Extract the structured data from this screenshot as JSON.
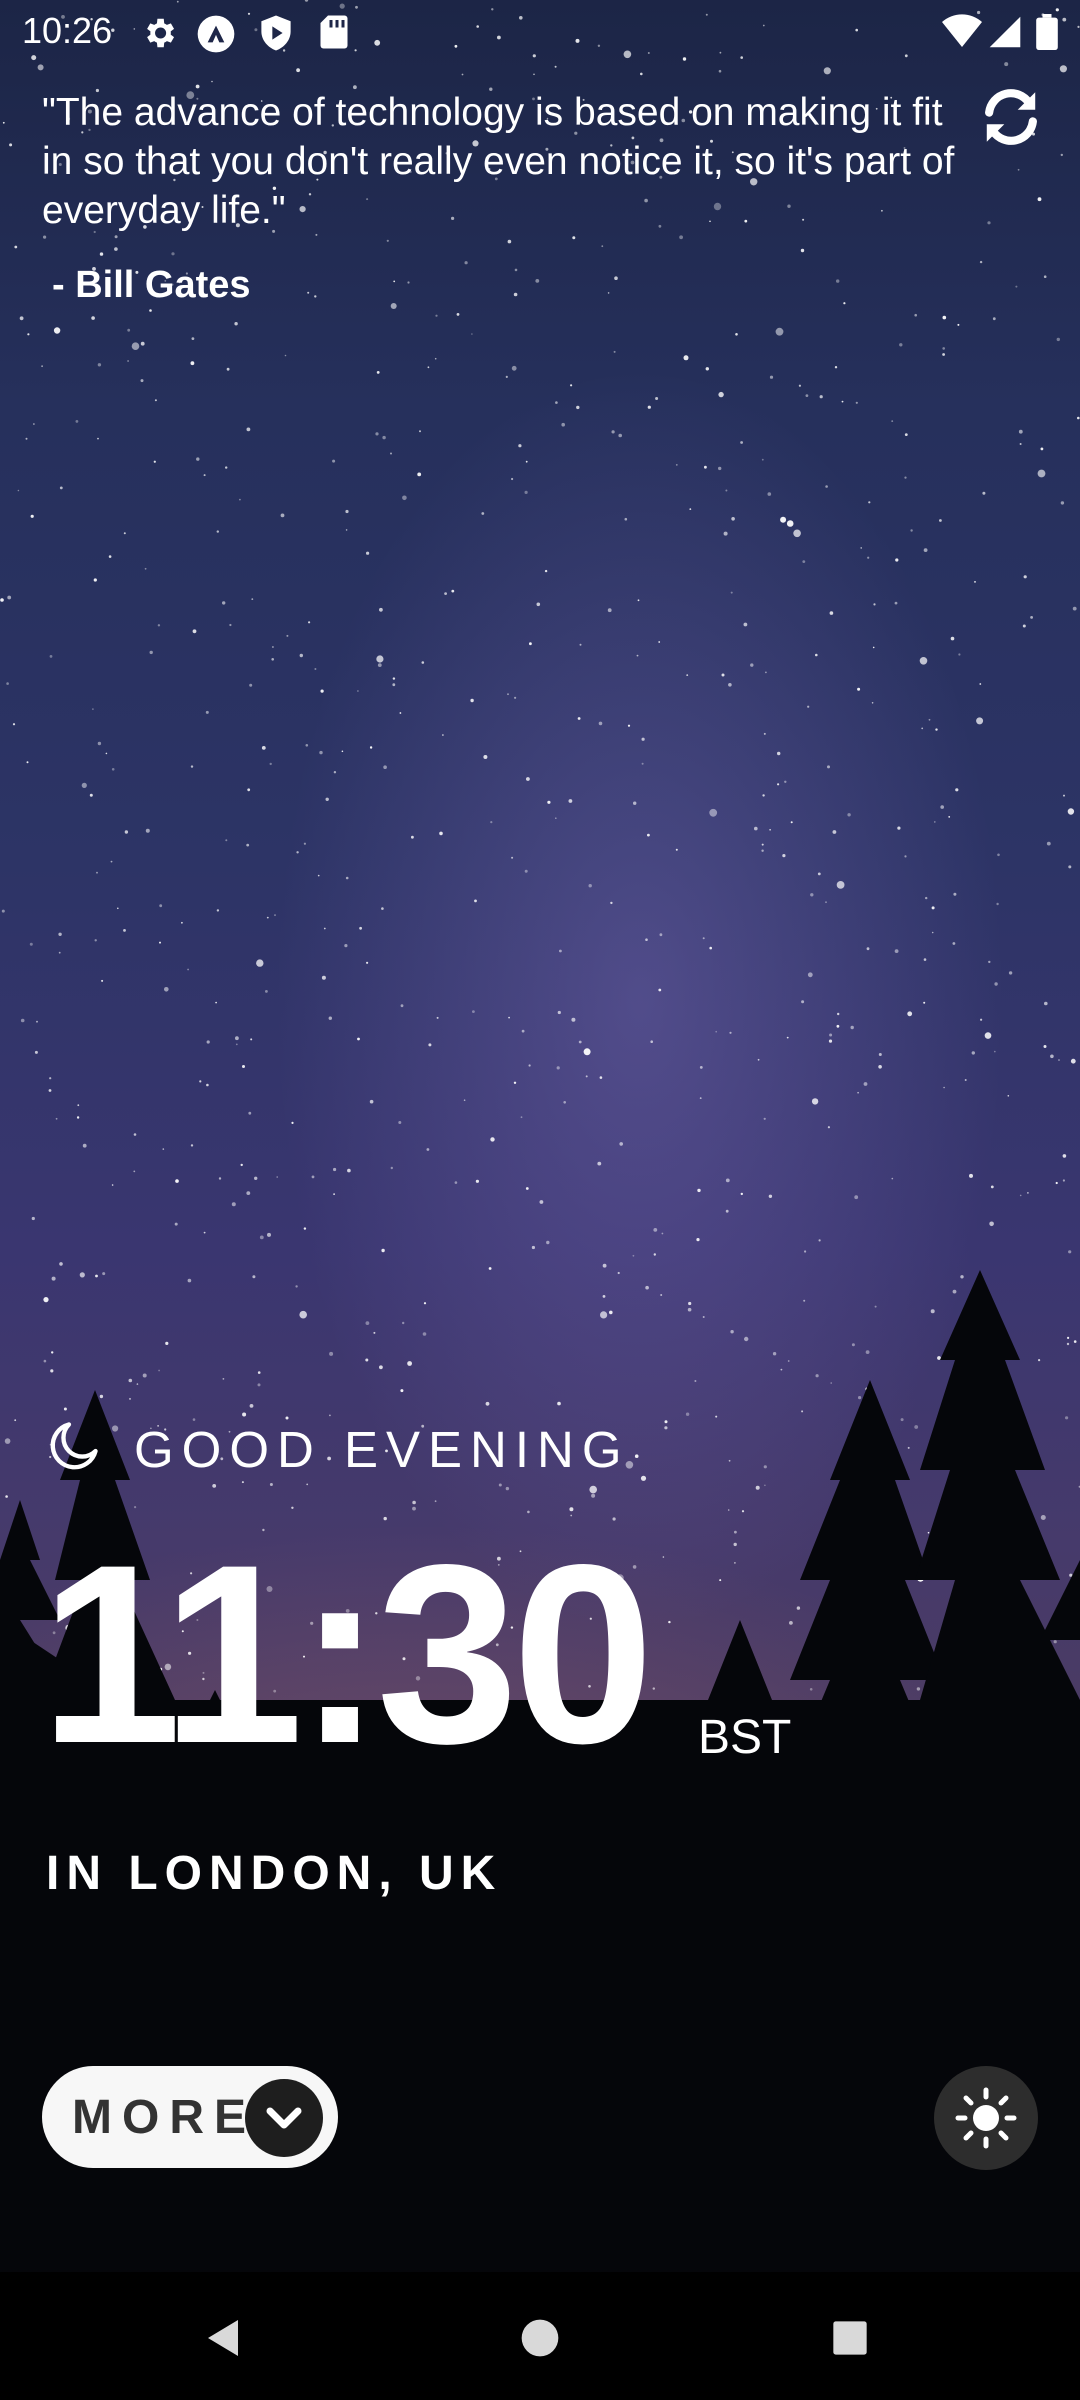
{
  "status_bar": {
    "time": "10:26",
    "left_icons": [
      "settings-icon",
      "app-a-icon",
      "shield-play-icon",
      "sd-card-icon"
    ],
    "right_icons": [
      "wifi-icon",
      "cell-signal-icon",
      "battery-icon"
    ]
  },
  "quote": {
    "text": "\"The advance of technology is based on making it fit in so that you don't really even notice it, so it's part of everyday life.\"",
    "author": " - Bill Gates",
    "refresh_icon": "refresh-icon"
  },
  "greeting": {
    "icon": "moon-icon",
    "text": "GOOD EVENING"
  },
  "clock": {
    "time": "11:30",
    "timezone": "BST",
    "location": "IN LONDON, UK"
  },
  "controls": {
    "more_label": "MORE",
    "more_icon": "chevron-down-icon",
    "theme_icon": "sun-icon"
  },
  "nav_bar": {
    "icons": [
      "back-icon",
      "home-icon",
      "recents-icon"
    ]
  },
  "colors": {
    "text": "#ffffff",
    "button_bg": "#f7f7f7",
    "button_text": "#333333",
    "chevron_bg": "#1e1e1e",
    "toggle_bg": "#2d2d2d",
    "sky_top": "#1c2546",
    "sky_mid": "#3a3670",
    "sky_horizon": "#4d3c5f"
  }
}
